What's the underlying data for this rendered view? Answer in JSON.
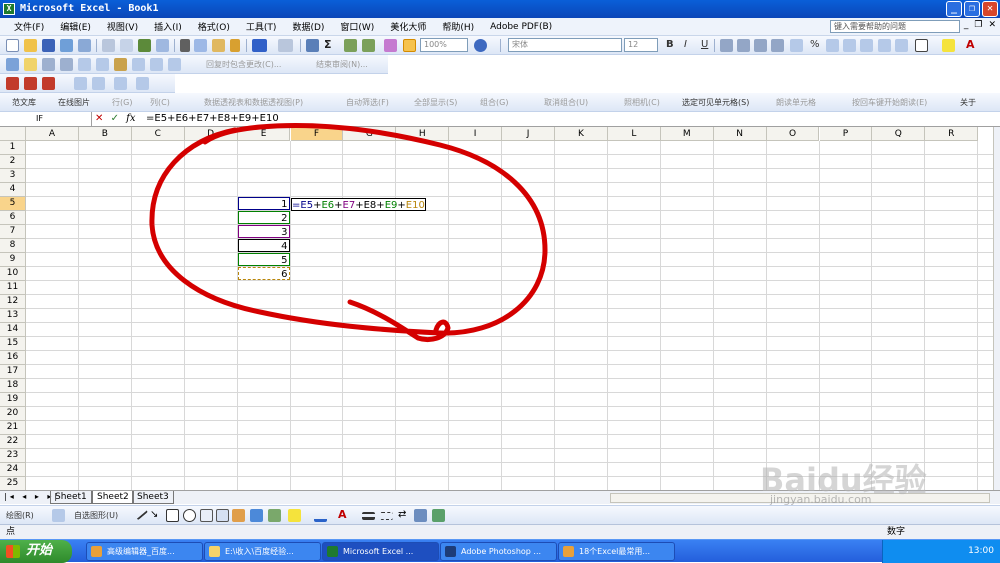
{
  "window": {
    "title": "Microsoft Excel - Book1",
    "app_icon": "X"
  },
  "menu": {
    "items": [
      "文件(F)",
      "编辑(E)",
      "视图(V)",
      "插入(I)",
      "格式(O)",
      "工具(T)",
      "数据(D)",
      "窗口(W)",
      "美化大师",
      "帮助(H)",
      "Adobe PDF(B)"
    ],
    "help_placeholder": "键入需要帮助的问题"
  },
  "toolbar": {
    "zoom": "100%",
    "font_name": "宋体",
    "font_size": "12",
    "bold": "B",
    "italic": "I",
    "underline": "U",
    "percent": "%",
    "review_reply": "回复时包含更改(C)...",
    "review_end": "结束审阅(N)..."
  },
  "toolbar2": {
    "templates": "范文库",
    "online_images": "在线图片",
    "row": "行(G)",
    "column": "列(C)",
    "pivot": "数据透视表和数据透视图(P)",
    "autofilter": "自动筛选(F)",
    "show_all": "全部显示(S)",
    "group": "组合(G)",
    "ungroup": "取消组合(U)",
    "camera": "照相机(C)",
    "select_visible": "选定可见单元格(S)",
    "read_cells": "朗读单元格",
    "read_enter": "按回车键开始朗读(E)",
    "about": "关于"
  },
  "formula_bar": {
    "name_box": "IF",
    "cancel": "✕",
    "enter": "✓",
    "fx": "fx",
    "content": "=E5+E6+E7+E8+E9+E10"
  },
  "sheet": {
    "columns": [
      "A",
      "B",
      "C",
      "D",
      "E",
      "F",
      "G",
      "H",
      "I",
      "J",
      "K",
      "L",
      "M",
      "N",
      "O",
      "P",
      "Q",
      "R"
    ],
    "rows": [
      "1",
      "2",
      "3",
      "4",
      "5",
      "6",
      "7",
      "8",
      "9",
      "10",
      "11",
      "12",
      "13",
      "14",
      "15",
      "16",
      "17",
      "18",
      "19",
      "20",
      "21",
      "22",
      "23",
      "24",
      "25"
    ],
    "active_column": "F",
    "active_row": "5",
    "values": {
      "E5": "1",
      "E6": "2",
      "E7": "3",
      "E8": "4",
      "E9": "5",
      "E10": "6"
    },
    "formula_parts": [
      "=E5",
      "+",
      "E6",
      "+",
      "E7",
      "+",
      "E8",
      "+",
      "E9",
      "+",
      "E10"
    ],
    "ref_colors": [
      "#00008b",
      "#000000",
      "#008000",
      "#000000",
      "#800080",
      "#000000",
      "#000000",
      "#000000",
      "#008000",
      "#000000",
      "#b8860b"
    ]
  },
  "tabs": {
    "sheets": [
      "Sheet1",
      "Sheet2",
      "Sheet3"
    ],
    "active": "Sheet2",
    "nav": "|◂ ◂ ▸ ▸|"
  },
  "drawing": {
    "draw_label": "绘图(R)",
    "autoshapes": "自选图形(U)"
  },
  "status": {
    "mode": "点",
    "num": "数字"
  },
  "taskbar": {
    "start": "开始",
    "tasks": [
      "高级编辑器_百度...",
      "E:\\收入\\百度经验...",
      "Microsoft Excel ...",
      "Adobe Photoshop ...",
      "18个Excel最常用..."
    ],
    "active_task": 2,
    "clock": "13:00"
  },
  "watermark": {
    "text": "Baidu经验",
    "url": "jingyan.baidu.com"
  },
  "colors": {
    "title_bar": "#0b46b8",
    "selection": "#f9d48b",
    "annotation": "#d40000",
    "taskbar": "#245edb"
  }
}
